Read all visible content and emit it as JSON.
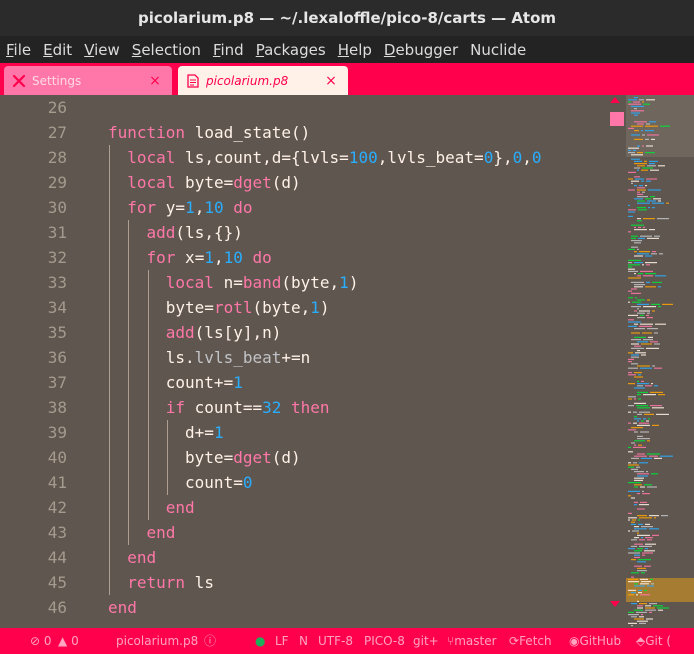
{
  "window": {
    "title": "picolarium.p8 — ~/.lexaloffle/pico-8/carts — Atom"
  },
  "menu": [
    {
      "label": "File",
      "accel": "F",
      "rest": "ile"
    },
    {
      "label": "Edit",
      "accel": "E",
      "rest": "dit"
    },
    {
      "label": "View",
      "accel": "V",
      "rest": "iew"
    },
    {
      "label": "Selection",
      "accel": "S",
      "rest": "election"
    },
    {
      "label": "Find",
      "accel": "F",
      "rest": "ind"
    },
    {
      "label": "Packages",
      "accel": "P",
      "rest": "ackages"
    },
    {
      "label": "Help",
      "accel": "H",
      "rest": "elp"
    },
    {
      "label": "Debugger",
      "accel": "D",
      "rest": "ebugger"
    },
    {
      "label": "Nuclide",
      "accel": "",
      "rest": "Nuclide"
    }
  ],
  "tabs": {
    "settings": {
      "label": "Settings",
      "icon": "settings-icon",
      "close": "×"
    },
    "file": {
      "label": "picolarium.p8",
      "icon": "file-icon",
      "close": "×"
    }
  },
  "editor": {
    "line_numbers": [
      "26",
      "27",
      "28",
      "29",
      "30",
      "31",
      "32",
      "33",
      "34",
      "35",
      "36",
      "37",
      "38",
      "39",
      "40",
      "41",
      "42",
      "43",
      "44",
      "45",
      "46"
    ],
    "lines": [
      {
        "indent": 0,
        "tokens": []
      },
      {
        "indent": 0,
        "tokens": [
          {
            "t": "function",
            "c": "kw"
          },
          {
            "t": " load_state()",
            "c": "fn-name"
          }
        ]
      },
      {
        "indent": 1,
        "tokens": [
          {
            "t": "local",
            "c": "kw"
          },
          {
            "t": " ls,count,d={lvls=",
            "c": ""
          },
          {
            "t": "100",
            "c": "num"
          },
          {
            "t": ",lvls_beat=",
            "c": ""
          },
          {
            "t": "0",
            "c": "num"
          },
          {
            "t": "},",
            "c": ""
          },
          {
            "t": "0",
            "c": "num"
          },
          {
            "t": ",",
            "c": ""
          },
          {
            "t": "0",
            "c": "num"
          }
        ]
      },
      {
        "indent": 1,
        "tokens": [
          {
            "t": "local",
            "c": "kw"
          },
          {
            "t": " byte=",
            "c": ""
          },
          {
            "t": "dget",
            "c": "fn"
          },
          {
            "t": "(d)",
            "c": ""
          }
        ]
      },
      {
        "indent": 1,
        "tokens": [
          {
            "t": "for",
            "c": "kw"
          },
          {
            "t": " y=",
            "c": ""
          },
          {
            "t": "1",
            "c": "num"
          },
          {
            "t": ",",
            "c": ""
          },
          {
            "t": "10",
            "c": "num"
          },
          {
            "t": " ",
            "c": ""
          },
          {
            "t": "do",
            "c": "kw"
          }
        ]
      },
      {
        "indent": 2,
        "tokens": [
          {
            "t": "add",
            "c": "fn"
          },
          {
            "t": "(ls,{})",
            "c": ""
          }
        ]
      },
      {
        "indent": 2,
        "tokens": [
          {
            "t": "for",
            "c": "kw"
          },
          {
            "t": " x=",
            "c": ""
          },
          {
            "t": "1",
            "c": "num"
          },
          {
            "t": ",",
            "c": ""
          },
          {
            "t": "10",
            "c": "num"
          },
          {
            "t": " ",
            "c": ""
          },
          {
            "t": "do",
            "c": "kw"
          }
        ]
      },
      {
        "indent": 3,
        "tokens": [
          {
            "t": "local",
            "c": "kw"
          },
          {
            "t": " n=",
            "c": ""
          },
          {
            "t": "band",
            "c": "fn"
          },
          {
            "t": "(byte,",
            "c": ""
          },
          {
            "t": "1",
            "c": "num"
          },
          {
            "t": ")",
            "c": ""
          }
        ]
      },
      {
        "indent": 3,
        "tokens": [
          {
            "t": "byte=",
            "c": ""
          },
          {
            "t": "rotl",
            "c": "fn"
          },
          {
            "t": "(byte,",
            "c": ""
          },
          {
            "t": "1",
            "c": "num"
          },
          {
            "t": ")",
            "c": ""
          }
        ]
      },
      {
        "indent": 3,
        "tokens": [
          {
            "t": "add",
            "c": "fn"
          },
          {
            "t": "(ls[y],n)",
            "c": ""
          }
        ]
      },
      {
        "indent": 3,
        "tokens": [
          {
            "t": "ls.",
            "c": ""
          },
          {
            "t": "lvls_beat",
            "c": "prop"
          },
          {
            "t": "+=n",
            "c": ""
          }
        ]
      },
      {
        "indent": 3,
        "tokens": [
          {
            "t": "count+=",
            "c": ""
          },
          {
            "t": "1",
            "c": "num"
          }
        ]
      },
      {
        "indent": 3,
        "tokens": [
          {
            "t": "if",
            "c": "kw"
          },
          {
            "t": " count==",
            "c": ""
          },
          {
            "t": "32",
            "c": "num"
          },
          {
            "t": " ",
            "c": ""
          },
          {
            "t": "then",
            "c": "kw"
          }
        ]
      },
      {
        "indent": 4,
        "tokens": [
          {
            "t": "d+=",
            "c": ""
          },
          {
            "t": "1",
            "c": "num"
          }
        ]
      },
      {
        "indent": 4,
        "tokens": [
          {
            "t": "byte=",
            "c": ""
          },
          {
            "t": "dget",
            "c": "fn"
          },
          {
            "t": "(d)",
            "c": ""
          }
        ]
      },
      {
        "indent": 4,
        "tokens": [
          {
            "t": "count=",
            "c": ""
          },
          {
            "t": "0",
            "c": "num"
          }
        ]
      },
      {
        "indent": 3,
        "tokens": [
          {
            "t": "end",
            "c": "kw"
          }
        ]
      },
      {
        "indent": 2,
        "tokens": [
          {
            "t": "end",
            "c": "kw"
          }
        ]
      },
      {
        "indent": 1,
        "tokens": [
          {
            "t": "end",
            "c": "kw"
          }
        ]
      },
      {
        "indent": 1,
        "tokens": [
          {
            "t": "return",
            "c": "kw"
          },
          {
            "t": " ls",
            "c": ""
          }
        ]
      },
      {
        "indent": 0,
        "tokens": [
          {
            "t": "end",
            "c": "kw"
          }
        ]
      }
    ]
  },
  "status": {
    "errors": "0",
    "warnings": "0",
    "file": "picolarium.p8",
    "line_ending": "LF",
    "indent_type": "N",
    "encoding": "UTF-8",
    "grammar": "PICO-8",
    "git_status": "git+",
    "branch": "master",
    "fetch": "Fetch",
    "github": "GitHub",
    "git": "Git ("
  },
  "colors": {
    "accent": "#ff004d",
    "keyword": "#ff77a8",
    "number": "#29adff",
    "background": "#5f574f",
    "text": "#fff1e8"
  }
}
